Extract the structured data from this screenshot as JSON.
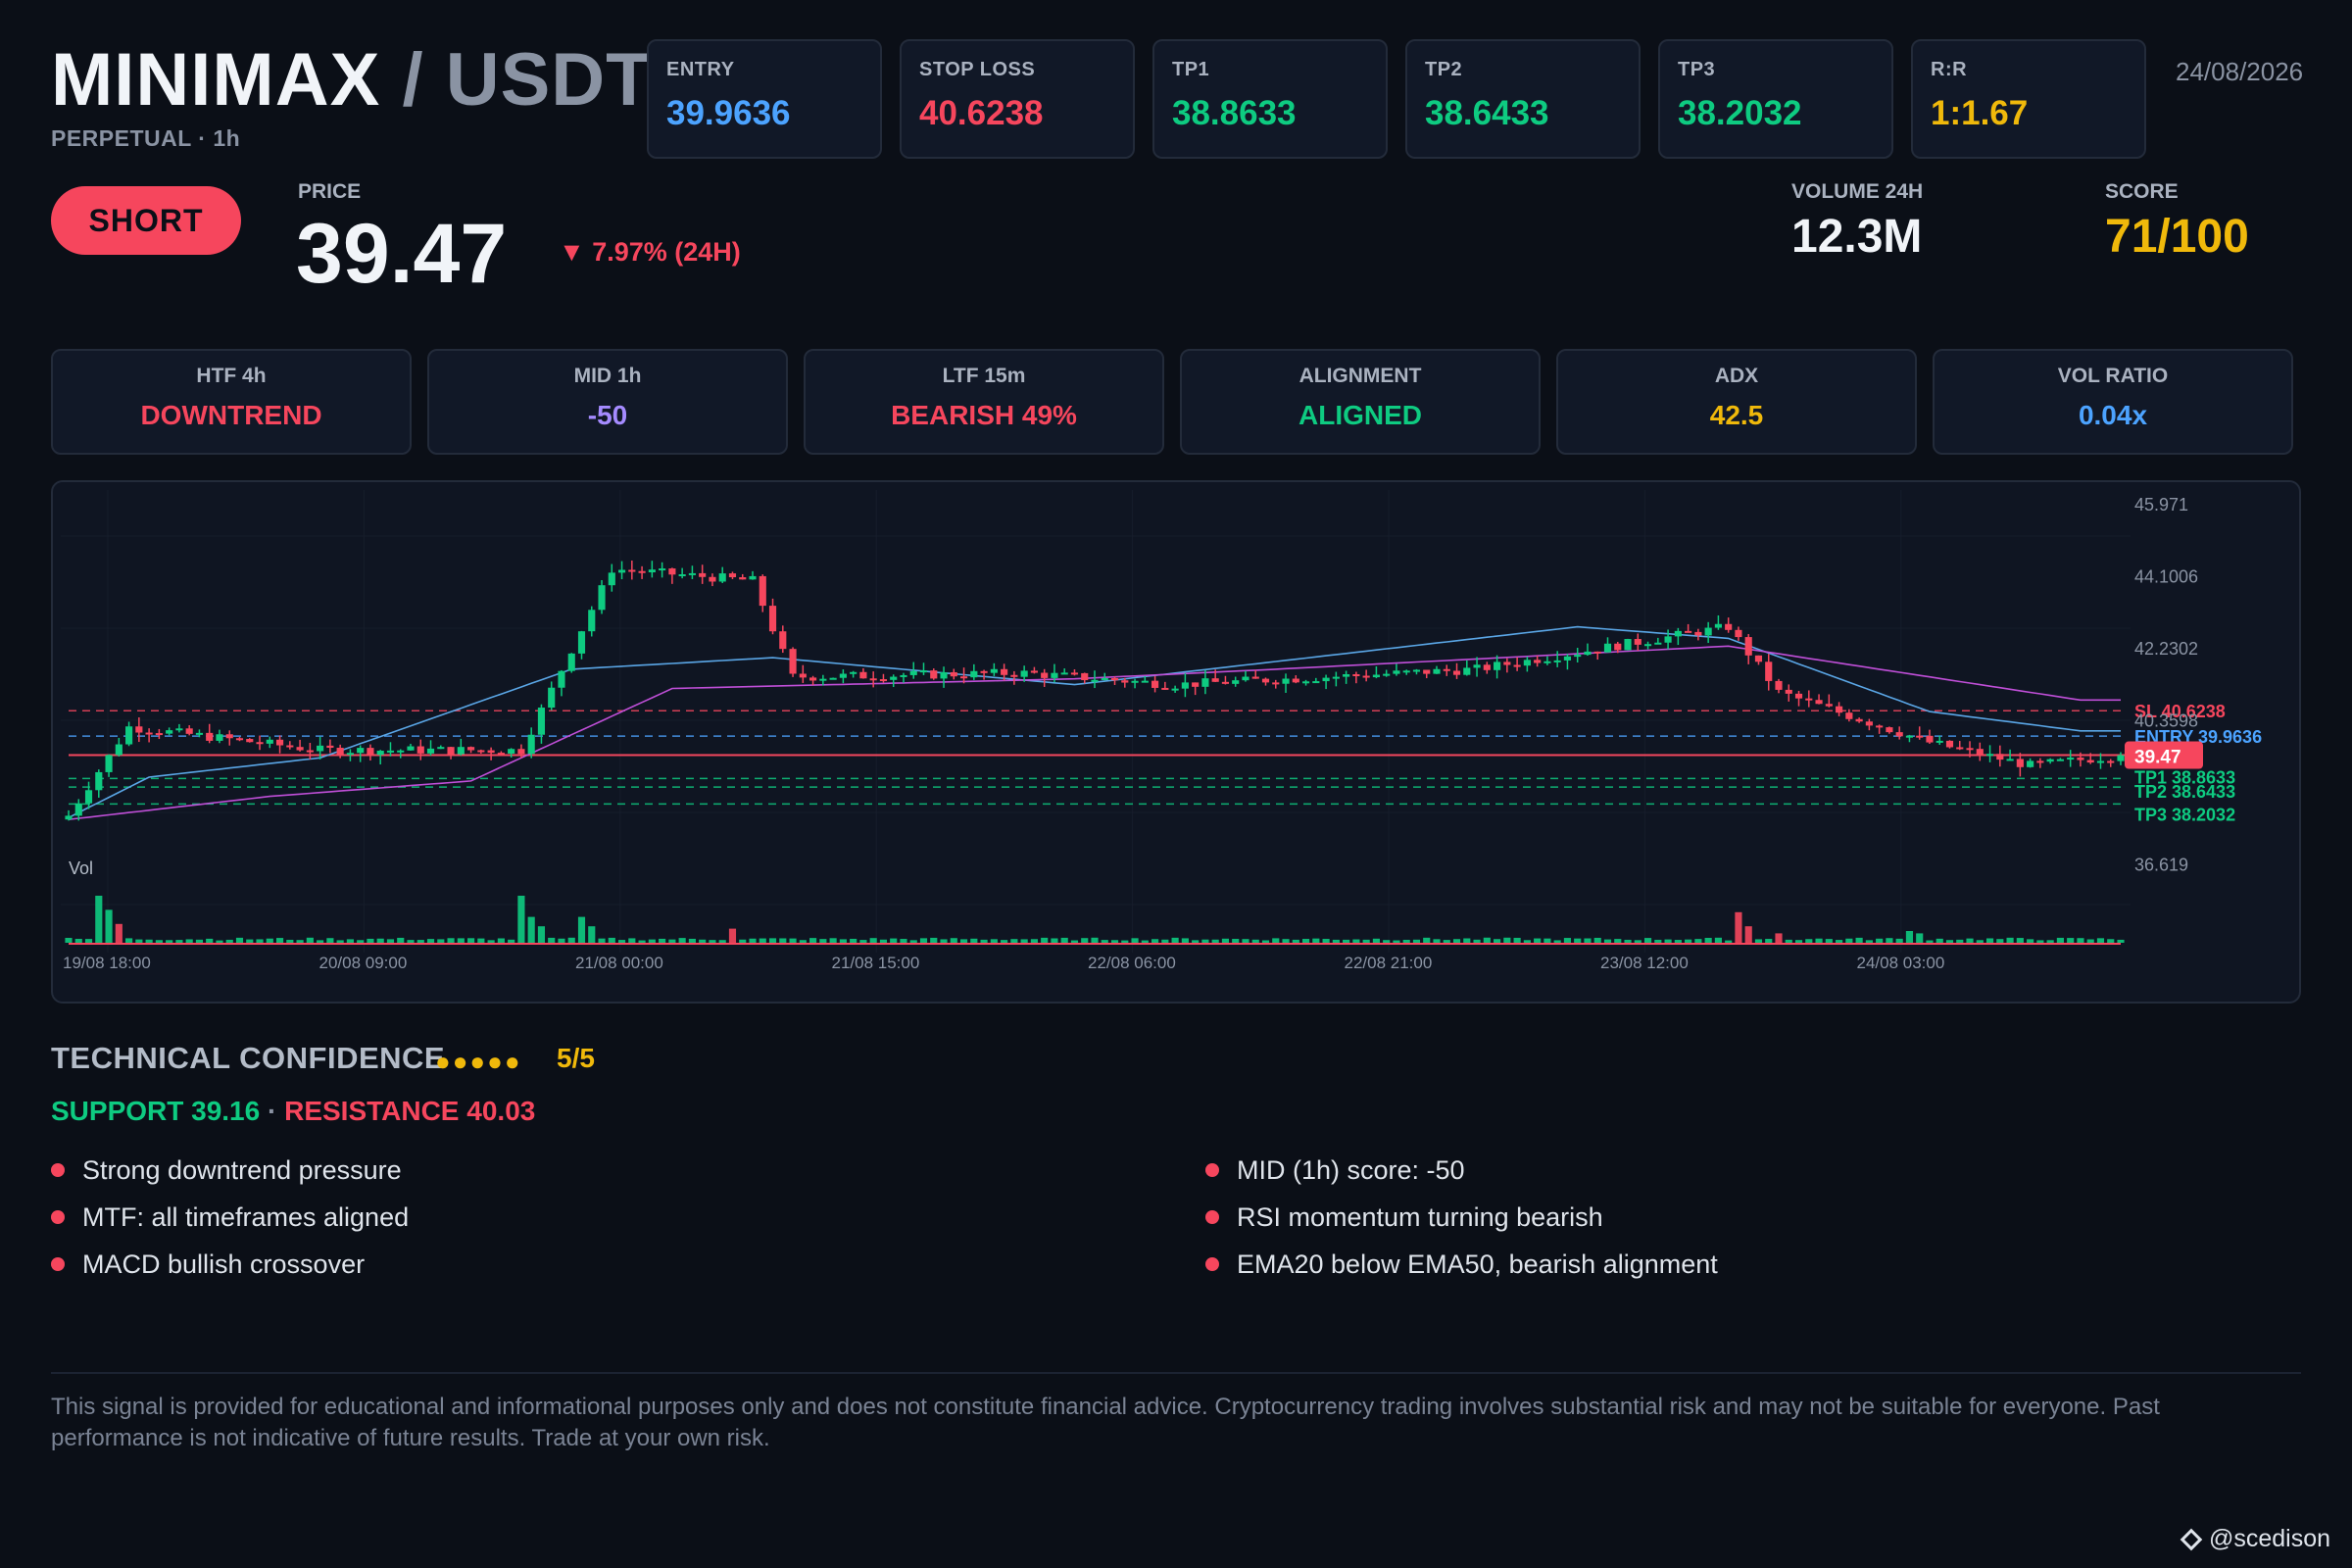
{
  "header": {
    "base": "MINIMAX",
    "separator": "/",
    "quote": "USDT",
    "subtitle": "PERPETUAL · 1h",
    "date": "24/08/2026"
  },
  "levels": [
    {
      "label": "ENTRY",
      "value": "39.9636",
      "color": "#4ca3ff"
    },
    {
      "label": "STOP LOSS",
      "value": "40.6238",
      "color": "#f6465d"
    },
    {
      "label": "TP1",
      "value": "38.8633",
      "color": "#0ecb81"
    },
    {
      "label": "TP2",
      "value": "38.6433",
      "color": "#0ecb81"
    },
    {
      "label": "TP3",
      "value": "38.2032",
      "color": "#0ecb81"
    },
    {
      "label": "R:R",
      "value": "1:1.67",
      "color": "#f0b90b"
    }
  ],
  "signal": {
    "side": "SHORT",
    "price_label": "PRICE",
    "price": "39.47",
    "change": "▼ 7.97% (24H)",
    "volume_label": "VOLUME 24H",
    "volume": "12.3M",
    "score_label": "SCORE",
    "score": "71/100"
  },
  "cards": [
    {
      "label": "HTF 4h",
      "value": "DOWNTREND",
      "color": "#f6465d"
    },
    {
      "label": "MID 1h",
      "value": "-50",
      "color": "#a58bff"
    },
    {
      "label": "LTF 15m",
      "value": "BEARISH 49%",
      "color": "#f6465d"
    },
    {
      "label": "ALIGNMENT",
      "value": "ALIGNED",
      "color": "#0ecb81"
    },
    {
      "label": "ADX",
      "value": "42.5",
      "color": "#f0b90b"
    },
    {
      "label": "VOL RATIO",
      "value": "0.04x",
      "color": "#4ca3ff"
    }
  ],
  "chart_data": {
    "type": "candlestick",
    "price_axis_ticks": [
      "45.971",
      "44.1006",
      "42.2302",
      "40.3598",
      "36.619"
    ],
    "x_ticks": [
      "19/08 18:00",
      "20/08 09:00",
      "21/08 00:00",
      "21/08 15:00",
      "22/08 06:00",
      "22/08 21:00",
      "23/08 12:00",
      "24/08 03:00"
    ],
    "ylim": [
      36.0,
      46.3
    ],
    "volume_label": "Vol",
    "level_lines": [
      {
        "label": "SL 40.6238",
        "value": 40.6238,
        "color": "#f6465d"
      },
      {
        "label": "ENTRY 39.9636",
        "value": 39.9636,
        "color": "#4ca3ff"
      },
      {
        "label": "TP1 38.8633",
        "value": 38.8633,
        "color": "#0ecb81"
      },
      {
        "label": "TP2 38.6433",
        "value": 38.6433,
        "color": "#0ecb81"
      },
      {
        "label": "TP3 38.2032",
        "value": 38.2032,
        "color": "#0ecb81"
      }
    ],
    "last_price": {
      "label": "39.47",
      "value": 39.47,
      "color": "#f6465d"
    },
    "key_closes": [
      {
        "time": "19/08 18:00",
        "close": 37.9
      },
      {
        "time": "19/08 23:00",
        "close": 40.2
      },
      {
        "time": "20/08 09:00",
        "close": 39.6
      },
      {
        "time": "20/08 20:00",
        "close": 39.6
      },
      {
        "time": "21/08 00:00",
        "close": 44.3
      },
      {
        "time": "21/08 05:00",
        "close": 44.0
      },
      {
        "time": "21/08 08:00",
        "close": 41.5
      },
      {
        "time": "21/08 15:00",
        "close": 41.6
      },
      {
        "time": "22/08 06:00",
        "close": 41.3
      },
      {
        "time": "22/08 21:00",
        "close": 41.7
      },
      {
        "time": "23/08 12:00",
        "close": 42.8
      },
      {
        "time": "23/08 17:00",
        "close": 41.1
      },
      {
        "time": "24/08 03:00",
        "close": 39.8
      },
      {
        "time": "24/08 13:00",
        "close": 39.47
      }
    ],
    "ema_fast": [
      [
        0,
        37.85
      ],
      [
        8,
        38.9
      ],
      [
        25,
        39.4
      ],
      [
        50,
        41.7
      ],
      [
        70,
        42.0
      ],
      [
        100,
        41.3
      ],
      [
        150,
        42.8
      ],
      [
        165,
        42.5
      ],
      [
        185,
        40.6
      ],
      [
        200,
        40.1
      ]
    ],
    "ema_slow": [
      [
        0,
        37.8
      ],
      [
        20,
        38.4
      ],
      [
        40,
        38.8
      ],
      [
        60,
        41.2
      ],
      [
        100,
        41.45
      ],
      [
        120,
        41.7
      ],
      [
        165,
        42.3
      ],
      [
        185,
        41.5
      ],
      [
        200,
        40.9
      ]
    ],
    "volume_spikes": [
      [
        3,
        1.0
      ],
      [
        4,
        0.7
      ],
      [
        5,
        0.4
      ],
      [
        45,
        1.0
      ],
      [
        46,
        0.55
      ],
      [
        47,
        0.35
      ],
      [
        51,
        0.55
      ],
      [
        52,
        0.35
      ],
      [
        66,
        0.3
      ],
      [
        166,
        0.65
      ],
      [
        167,
        0.35
      ],
      [
        170,
        0.2
      ],
      [
        183,
        0.25
      ],
      [
        184,
        0.2
      ]
    ]
  },
  "technical": {
    "title": "TECHNICAL CONFIDENCE",
    "dots": "●●●●●",
    "score": "5/5",
    "support": "SUPPORT 39.16",
    "sep": "·",
    "resistance": "RESISTANCE 40.03",
    "left": [
      "Strong downtrend pressure",
      "MTF: all timeframes aligned",
      "MACD bullish crossover"
    ],
    "right": [
      "MID (1h) score: -50",
      "RSI momentum turning bearish",
      "EMA20 below EMA50, bearish alignment"
    ]
  },
  "disclaimer": "This signal is provided for educational and informational purposes only and does not constitute financial advice. Cryptocurrency trading involves substantial risk and may not be suitable for everyone. Past performance is not indicative of future results. Trade at your own risk.",
  "brand": "@scedison",
  "colors": {
    "up": "#0ecb81",
    "down": "#f6465d",
    "ema_fast": "#5aa6e6",
    "ema_slow": "#c04fd8"
  }
}
